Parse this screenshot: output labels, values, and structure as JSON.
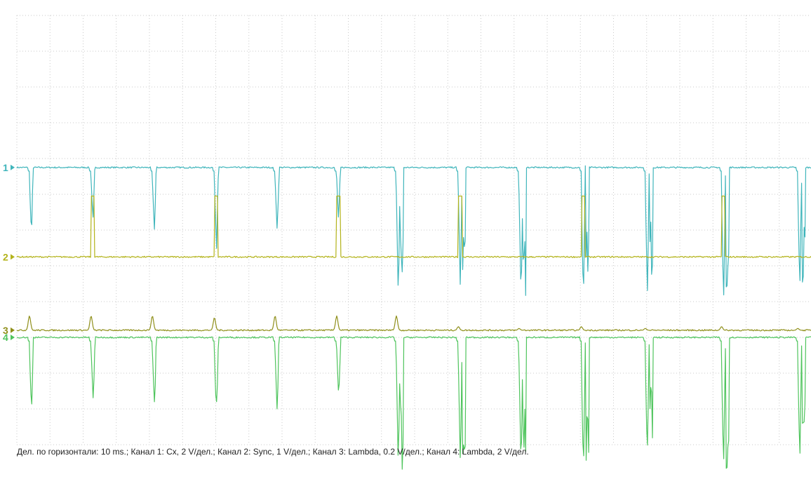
{
  "caption": "Дел. по горизонтали: 10 ms.; Канал 1: Сх, 2 V/дел.; Канал 2: Sync, 1 V/дел.; Канал 3: Lambda, 0.2 V/дел.; Канал 4: Lambda, 2 V/дел.",
  "chart_data": {
    "type": "line",
    "title": "",
    "grid": true,
    "x": {
      "unit": "ms",
      "per_division": 10,
      "divisions": 24,
      "range": [
        0,
        240
      ]
    },
    "y": {
      "unit": "div",
      "divisions": 12,
      "range": [
        0,
        12
      ]
    },
    "channels": [
      {
        "id": "ch1",
        "marker": "1",
        "name": "Сх",
        "scale": "2 V/дел.",
        "color": "#3fb5bb",
        "baseline_div": 7.75,
        "dip_depth_div": 1.9,
        "dips_ms": [
          3.8,
          22.4,
          40.9,
          59.6,
          77.9,
          96.5,
          114.5,
          133.2,
          151.5,
          170.3,
          189.6,
          212.6,
          235.6
        ],
        "dip_depths_div": [
          1.9,
          1.6,
          1.8,
          2.2,
          1.7,
          1.6,
          3.8,
          3.5,
          3.6,
          3.7,
          3.5,
          3.8,
          3.5
        ]
      },
      {
        "id": "ch2",
        "marker": "2",
        "name": "Sync",
        "scale": "1 V/дел.",
        "color": "#b3b31a",
        "baseline_div": 5.25,
        "pulses_ms": [
          22.4,
          59.6,
          96.5,
          133.2,
          170.3,
          212.6
        ],
        "pulse_height_div": 1.7
      },
      {
        "id": "ch3",
        "marker": "3",
        "name": "Lambda",
        "scale": "0.2 V/дел.",
        "color": "#8f8f1a",
        "baseline_div": 3.2,
        "bumps_ms": [
          3.8,
          22.4,
          40.9,
          59.6,
          77.9,
          96.5,
          114.5,
          133.2,
          151.5,
          170.3,
          189.6,
          212.6,
          235.6
        ],
        "bump_heights_div": [
          0.4,
          0.4,
          0.4,
          0.35,
          0.4,
          0.4,
          0.4,
          0.1,
          0.05,
          0.1,
          0.05,
          0.1,
          0.05
        ]
      },
      {
        "id": "ch4",
        "marker": "4",
        "name": "Lambda",
        "scale": "2 V/дел.",
        "color": "#4ec45c",
        "baseline_div": 3.0,
        "dips_ms": [
          3.8,
          22.4,
          40.9,
          59.6,
          77.9,
          96.5,
          114.5,
          133.2,
          151.5,
          170.3,
          189.6,
          212.6,
          235.6
        ],
        "dip_depths_div": [
          2.0,
          1.7,
          1.9,
          2.2,
          2.0,
          1.7,
          3.8,
          3.6,
          3.6,
          3.7,
          3.5,
          3.7,
          3.5
        ]
      }
    ]
  }
}
